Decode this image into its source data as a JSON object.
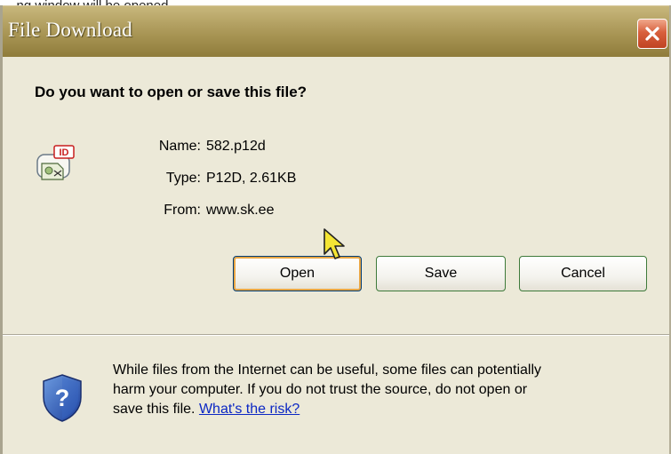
{
  "top_caption": "...ng window will be opened",
  "dialog": {
    "title": "File Download",
    "question": "Do you want to open or save this file?",
    "file_icon": "id-card-file-icon",
    "info": [
      {
        "label": "Name:",
        "value": "582.p12d"
      },
      {
        "label": "Type:",
        "value": "P12D, 2.61KB"
      },
      {
        "label": "From:",
        "value": "www.sk.ee"
      }
    ],
    "buttons": {
      "open": "Open",
      "save": "Save",
      "cancel": "Cancel"
    },
    "warning": {
      "icon": "security-shield-question-icon",
      "line1": "While files from the Internet can be useful, some files can potentially",
      "line2": "harm your computer. If you do not trust the source, do not open or",
      "line3_prefix": "save this file.",
      "link": "What's the risk?"
    }
  },
  "colors": {
    "titlebar": "#a49150",
    "dialog_bg": "#ece9d8",
    "close_button": "#d8603d",
    "link": "#0b27c4"
  }
}
